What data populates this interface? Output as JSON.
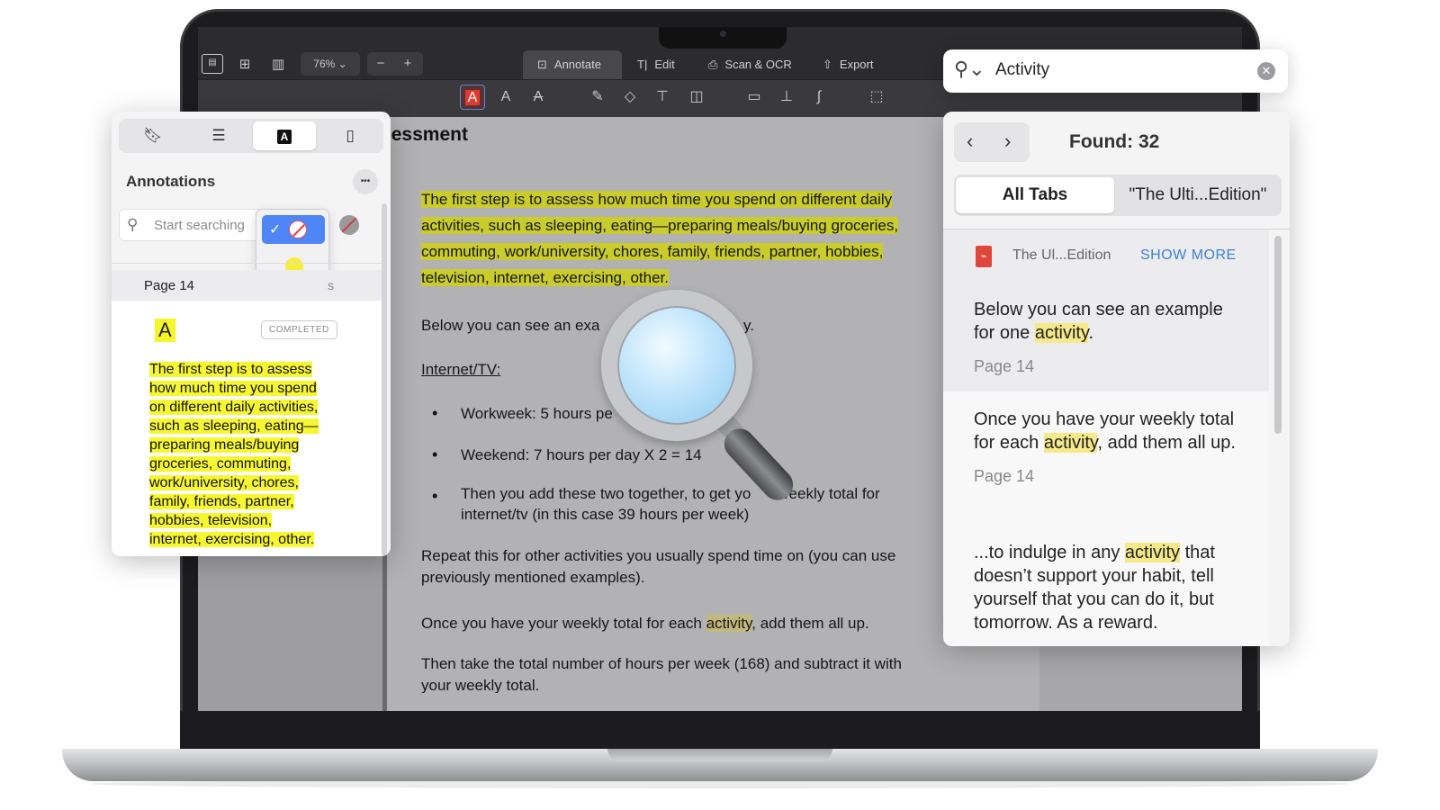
{
  "toolbar": {
    "zoom": "76% ⌄",
    "zoom_minus": "−",
    "zoom_plus": "+",
    "modes": [
      "Annotate",
      "Edit",
      "Scan & OCR",
      "Export"
    ],
    "text_tool": "A"
  },
  "document": {
    "title": "Personal Time Assessment",
    "p1": "The first step is to assess how much time you spend on different daily activities, such as sleeping, eating—preparing meals/buying groceries, commuting, work/university, chores, family, friends, partner, hobbies, television, internet, exercising, other.",
    "p1_lines": [
      "The first step is to assess how much time you spend on different daily",
      "activities, such as sleeping, eating—preparing meals/buying groceries,",
      "commuting, work/university, chores, family, friends, partner, hobbies,",
      "television, internet, exercising, other."
    ],
    "p2_start": "Below you can see an exa",
    "p2_end": "y.",
    "section": "Internet/TV:",
    "bullets": [
      "Workweek: 5 hours pe",
      "Weekend: 7 hours per day X 2 = 14",
      "Then you add these two together, to get yo",
      "weekly total for",
      "internet/tv (in this case 39 hours per week)"
    ],
    "p3_l1": "Repeat this for other activities you usually spend time on (you can use",
    "p3_l2": "previously mentioned examples).",
    "p4_pre": "Once you have your weekly total for each ",
    "p4_hl": "activity",
    "p4_post": ", add them all up.",
    "p5_l1": "Then take the total number of hours per week (168) and subtract it with",
    "p5_l2": "your weekly total."
  },
  "annotations": {
    "title": "Annotations",
    "more": "•••",
    "search_placeholder": "Start searching",
    "page_label": "Page 14",
    "partial_label": "s",
    "item_icon": "A",
    "badge": "COMPLETED",
    "item_lines": [
      "The first step is to assess",
      "how much time you spend",
      "on different daily activities,",
      "such as sleeping, eating—",
      "preparing meals/buying",
      "groceries, commuting,",
      "work/university, chores,",
      "family, friends, partner,",
      "hobbies, television,",
      "internet, exercising, other."
    ],
    "colors": {
      "yellow": "#f5ef3a",
      "red": "#e6372c"
    }
  },
  "search": {
    "query": "Activity",
    "found": "Found: 32",
    "tabs": [
      "All Tabs",
      "\"The Ulti...Edition\""
    ],
    "file_name": "The Ul...Edition",
    "show_more": "SHOW MORE",
    "results": [
      {
        "pre": "Below you can see an example for one ",
        "hl": "activity",
        "post": ".",
        "page": "Page 14"
      },
      {
        "pre": "Once you have your weekly total for each ",
        "hl": "activity",
        "post": ", add them all up.",
        "page": "Page 14"
      },
      {
        "pre": "...to indulge in any ",
        "hl": "activity",
        "post": " that doesn’t support your habit, tell yourself that you can do it, but tomorrow. As a reward.",
        "page": ""
      }
    ]
  }
}
